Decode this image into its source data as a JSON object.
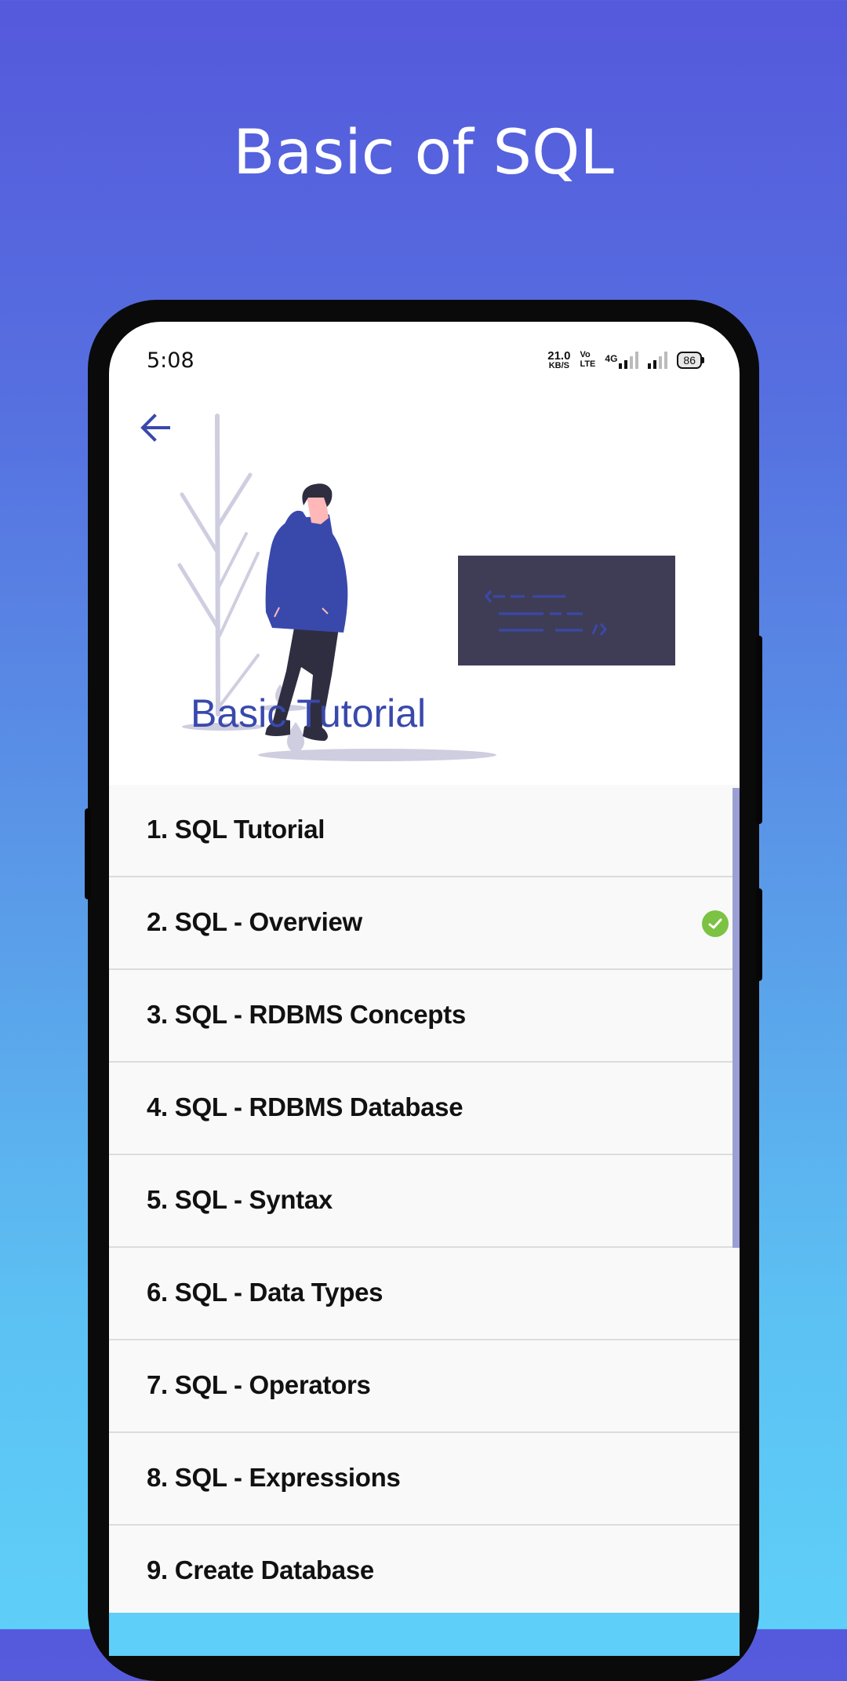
{
  "promo": {
    "title": "Basic of SQL"
  },
  "status_bar": {
    "time": "5:08",
    "net_speed_value": "21.0",
    "net_speed_unit": "KB/S",
    "volte_top": "Vo",
    "volte_bottom": "LTE",
    "network_type": "4G",
    "battery_level": "86"
  },
  "header": {
    "back_icon": "arrow-left-icon",
    "title": "Basic Tutorial"
  },
  "lessons": [
    {
      "label": "1. SQL Tutorial",
      "completed": false
    },
    {
      "label": "2. SQL - Overview",
      "completed": true
    },
    {
      "label": "3. SQL - RDBMS Concepts",
      "completed": false
    },
    {
      "label": "4. SQL - RDBMS Database",
      "completed": false
    },
    {
      "label": "5. SQL - Syntax",
      "completed": false
    },
    {
      "label": "6. SQL - Data Types",
      "completed": false
    },
    {
      "label": "7. SQL - Operators",
      "completed": false
    },
    {
      "label": "8. SQL - Expressions",
      "completed": false
    },
    {
      "label": "9. Create Database",
      "completed": false
    }
  ],
  "colors": {
    "accent": "#3949AB",
    "completed": "#7CC243",
    "scrollbar": "#9AA0D4",
    "gradient_top": "#5559DC",
    "gradient_bottom": "#5ECFF8"
  }
}
